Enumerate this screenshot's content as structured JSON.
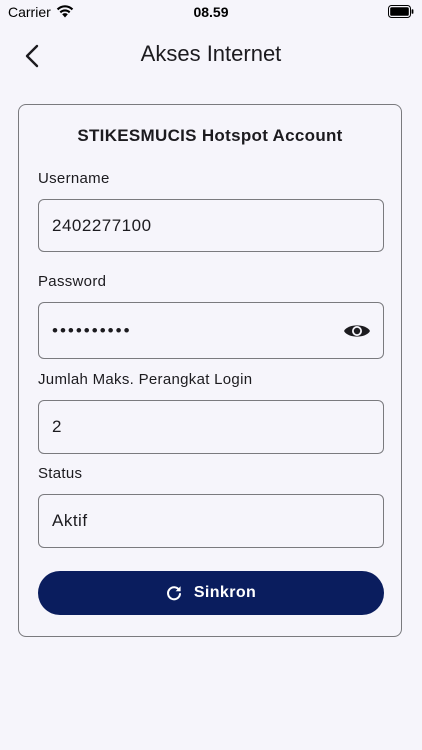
{
  "status_bar": {
    "carrier": "Carrier",
    "time": "08.59"
  },
  "header": {
    "title": "Akses Internet",
    "back_icon": "chevron-left-icon"
  },
  "account_card": {
    "title": "STIKESMUCIS Hotspot Account",
    "fields": {
      "username": {
        "label": "Username",
        "value": "2402277100"
      },
      "password": {
        "label": "Password",
        "value": "••••••••••",
        "toggle_icon": "eye-icon"
      },
      "max_devices": {
        "label": "Jumlah Maks. Perangkat Login",
        "value": "2"
      },
      "status": {
        "label": "Status",
        "value": "Aktif"
      }
    },
    "sync_button": {
      "label": "Sinkron",
      "icon": "refresh-icon"
    }
  },
  "colors": {
    "background": "#f6f5fb",
    "primary": "#0a1d5e",
    "outline": "#7a7a7e",
    "text": "#1c1b1f"
  }
}
